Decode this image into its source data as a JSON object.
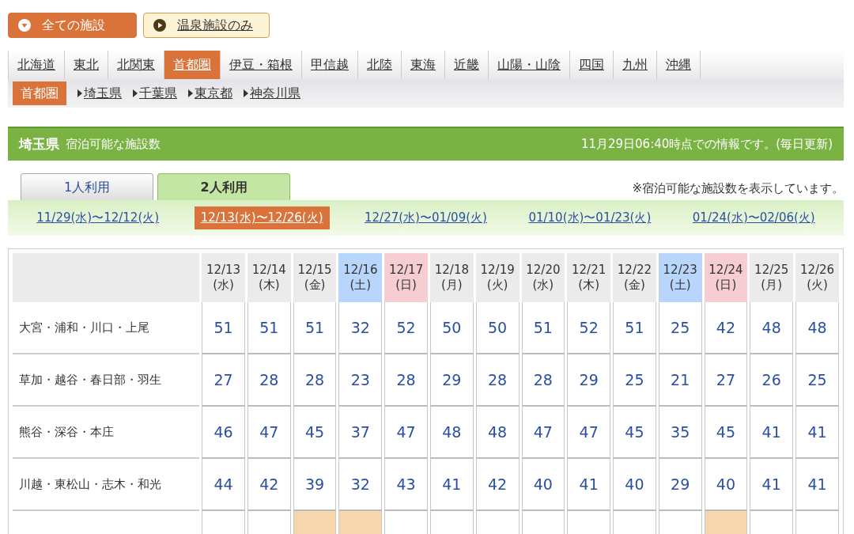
{
  "filter_buttons": [
    {
      "label": "全ての施設",
      "selected": true
    },
    {
      "label": "温泉施設のみ",
      "selected": false
    }
  ],
  "region_tabs": [
    {
      "label": "北海道",
      "selected": false
    },
    {
      "label": "東北",
      "selected": false
    },
    {
      "label": "北関東",
      "selected": false
    },
    {
      "label": "首都圏",
      "selected": true
    },
    {
      "label": "伊豆・箱根",
      "selected": false
    },
    {
      "label": "甲信越",
      "selected": false
    },
    {
      "label": "北陸",
      "selected": false
    },
    {
      "label": "東海",
      "selected": false
    },
    {
      "label": "近畿",
      "selected": false
    },
    {
      "label": "山陽・山陰",
      "selected": false
    },
    {
      "label": "四国",
      "selected": false
    },
    {
      "label": "九州",
      "selected": false
    },
    {
      "label": "沖縄",
      "selected": false
    }
  ],
  "sub_nav": {
    "current": "首都圏",
    "links": [
      "埼玉県",
      "千葉県",
      "東京都",
      "神奈川県"
    ]
  },
  "header": {
    "prefecture": "埼玉県",
    "subtitle": "宿泊可能な施設数",
    "updated": "11月29日06:40時点での情報です。(毎日更新)"
  },
  "guest_tabs": [
    {
      "label": "1人利用",
      "selected": false
    },
    {
      "label": "2人利用",
      "selected": true
    }
  ],
  "note": "※宿泊可能な施設数を表示しています。",
  "periods": [
    {
      "label": "11/29(水)〜12/12(火)",
      "selected": false
    },
    {
      "label": "12/13(水)〜12/26(火)",
      "selected": true
    },
    {
      "label": "12/27(水)〜01/09(火)",
      "selected": false
    },
    {
      "label": "01/10(水)〜01/23(火)",
      "selected": false
    },
    {
      "label": "01/24(水)〜02/06(火)",
      "selected": false
    }
  ],
  "table": {
    "columns": [
      {
        "date": "12/13",
        "day": "(水)",
        "kind": "weekday"
      },
      {
        "date": "12/14",
        "day": "(木)",
        "kind": "weekday"
      },
      {
        "date": "12/15",
        "day": "(金)",
        "kind": "weekday"
      },
      {
        "date": "12/16",
        "day": "(土)",
        "kind": "saturday"
      },
      {
        "date": "12/17",
        "day": "(日)",
        "kind": "sunday"
      },
      {
        "date": "12/18",
        "day": "(月)",
        "kind": "weekday"
      },
      {
        "date": "12/19",
        "day": "(火)",
        "kind": "weekday"
      },
      {
        "date": "12/20",
        "day": "(水)",
        "kind": "weekday"
      },
      {
        "date": "12/21",
        "day": "(木)",
        "kind": "weekday"
      },
      {
        "date": "12/22",
        "day": "(金)",
        "kind": "weekday"
      },
      {
        "date": "12/23",
        "day": "(土)",
        "kind": "saturday"
      },
      {
        "date": "12/24",
        "day": "(日)",
        "kind": "sunday"
      },
      {
        "date": "12/25",
        "day": "(月)",
        "kind": "weekday"
      },
      {
        "date": "12/26",
        "day": "(火)",
        "kind": "weekday"
      }
    ],
    "rows": [
      {
        "area": "大宮・浦和・川口・上尾",
        "cells": [
          {
            "value": "51",
            "highlighted": false
          },
          {
            "value": "51",
            "highlighted": false
          },
          {
            "value": "51",
            "highlighted": false
          },
          {
            "value": "32",
            "highlighted": false
          },
          {
            "value": "52",
            "highlighted": false
          },
          {
            "value": "50",
            "highlighted": false
          },
          {
            "value": "50",
            "highlighted": false
          },
          {
            "value": "51",
            "highlighted": false
          },
          {
            "value": "52",
            "highlighted": false
          },
          {
            "value": "51",
            "highlighted": false
          },
          {
            "value": "25",
            "highlighted": false
          },
          {
            "value": "42",
            "highlighted": false
          },
          {
            "value": "48",
            "highlighted": false
          },
          {
            "value": "48",
            "highlighted": false
          }
        ]
      },
      {
        "area": "草加・越谷・春日部・羽生",
        "cells": [
          {
            "value": "27",
            "highlighted": false
          },
          {
            "value": "28",
            "highlighted": false
          },
          {
            "value": "28",
            "highlighted": false
          },
          {
            "value": "23",
            "highlighted": false
          },
          {
            "value": "28",
            "highlighted": false
          },
          {
            "value": "29",
            "highlighted": false
          },
          {
            "value": "28",
            "highlighted": false
          },
          {
            "value": "28",
            "highlighted": false
          },
          {
            "value": "29",
            "highlighted": false
          },
          {
            "value": "25",
            "highlighted": false
          },
          {
            "value": "21",
            "highlighted": false
          },
          {
            "value": "27",
            "highlighted": false
          },
          {
            "value": "26",
            "highlighted": false
          },
          {
            "value": "25",
            "highlighted": false
          }
        ]
      },
      {
        "area": "熊谷・深谷・本庄",
        "cells": [
          {
            "value": "46",
            "highlighted": false
          },
          {
            "value": "47",
            "highlighted": false
          },
          {
            "value": "45",
            "highlighted": false
          },
          {
            "value": "37",
            "highlighted": false
          },
          {
            "value": "47",
            "highlighted": false
          },
          {
            "value": "48",
            "highlighted": false
          },
          {
            "value": "48",
            "highlighted": false
          },
          {
            "value": "47",
            "highlighted": false
          },
          {
            "value": "47",
            "highlighted": false
          },
          {
            "value": "45",
            "highlighted": false
          },
          {
            "value": "35",
            "highlighted": false
          },
          {
            "value": "45",
            "highlighted": false
          },
          {
            "value": "41",
            "highlighted": false
          },
          {
            "value": "41",
            "highlighted": false
          }
        ]
      },
      {
        "area": "川越・東松山・志木・和光",
        "cells": [
          {
            "value": "44",
            "highlighted": false
          },
          {
            "value": "42",
            "highlighted": false
          },
          {
            "value": "39",
            "highlighted": false
          },
          {
            "value": "32",
            "highlighted": false
          },
          {
            "value": "43",
            "highlighted": false
          },
          {
            "value": "41",
            "highlighted": false
          },
          {
            "value": "42",
            "highlighted": false
          },
          {
            "value": "40",
            "highlighted": false
          },
          {
            "value": "41",
            "highlighted": false
          },
          {
            "value": "40",
            "highlighted": false
          },
          {
            "value": "29",
            "highlighted": false
          },
          {
            "value": "40",
            "highlighted": false
          },
          {
            "value": "41",
            "highlighted": false
          },
          {
            "value": "41",
            "highlighted": false
          }
        ]
      },
      {
        "cells": [
          {
            "highlighted": false
          },
          {
            "highlighted": false
          },
          {
            "highlighted": true
          },
          {
            "highlighted": true
          },
          {
            "highlighted": false
          },
          {
            "highlighted": false
          },
          {
            "highlighted": false
          },
          {
            "highlighted": false
          },
          {
            "highlighted": false
          },
          {
            "highlighted": false
          },
          {
            "highlighted": false
          },
          {
            "highlighted": true
          },
          {
            "highlighted": false
          },
          {
            "highlighted": false
          }
        ]
      }
    ]
  }
}
